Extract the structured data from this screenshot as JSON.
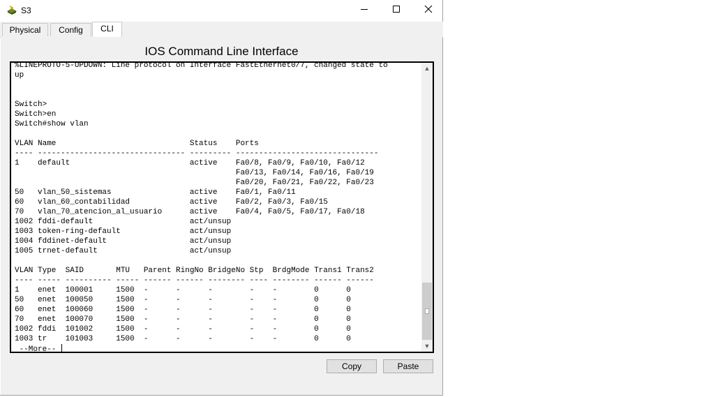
{
  "window": {
    "title": "S3",
    "icon": "switch-icon",
    "controls": [
      "minimize-icon",
      "maximize-icon",
      "close-icon"
    ]
  },
  "tabs": [
    {
      "label": "Physical",
      "active": false
    },
    {
      "label": "Config",
      "active": false
    },
    {
      "label": "CLI",
      "active": true
    }
  ],
  "cli": {
    "heading": "IOS Command Line Interface",
    "lines": [
      "%LINEPROTO-5-UPDOWN: Line protocol on Interface FastEthernet0/7, changed state to",
      "up",
      "",
      "",
      "Switch>",
      "Switch>en",
      "Switch#show vlan",
      "",
      "VLAN Name                             Status    Ports",
      "---- -------------------------------- --------- -------------------------------",
      "1    default                          active    Fa0/8, Fa0/9, Fa0/10, Fa0/12",
      "                                                Fa0/13, Fa0/14, Fa0/16, Fa0/19",
      "                                                Fa0/20, Fa0/21, Fa0/22, Fa0/23",
      "50   vlan_50_sistemas                 active    Fa0/1, Fa0/11",
      "60   vlan_60_contabilidad             active    Fa0/2, Fa0/3, Fa0/15",
      "70   vlan_70_atencion_al_usuario      active    Fa0/4, Fa0/5, Fa0/17, Fa0/18",
      "1002 fddi-default                     act/unsup",
      "1003 token-ring-default               act/unsup",
      "1004 fddinet-default                  act/unsup",
      "1005 trnet-default                    act/unsup",
      "",
      "VLAN Type  SAID       MTU   Parent RingNo BridgeNo Stp  BrdgMode Trans1 Trans2",
      "---- ----- ---------- ----- ------ ------ -------- ---- -------- ------ ------",
      "1    enet  100001     1500  -      -      -        -    -        0      0",
      "50   enet  100050     1500  -      -      -        -    -        0      0",
      "60   enet  100060     1500  -      -      -        -    -        0      0",
      "70   enet  100070     1500  -      -      -        -    -        0      0",
      "1002 fddi  101002     1500  -      -      -        -    -        0      0",
      "1003 tr    101003     1500  -      -      -        -    -        0      0"
    ],
    "prompt": " --More-- "
  },
  "buttons": {
    "copy": "Copy",
    "paste": "Paste"
  }
}
